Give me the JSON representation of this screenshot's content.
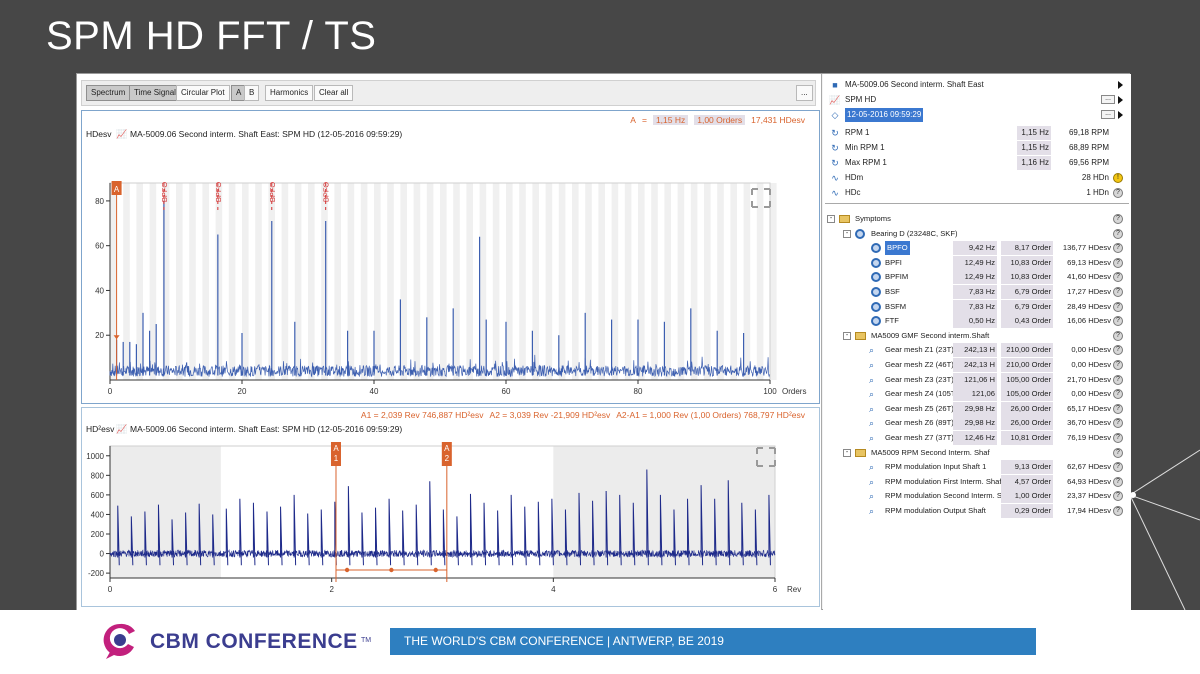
{
  "slide": {
    "title": "SPM HD FFT / TS"
  },
  "toolbar": {
    "buttons": [
      "Spectrum",
      "Time Signal",
      "Circular Plot",
      "A",
      "B",
      "Harmonics",
      "Clear all",
      "..."
    ]
  },
  "spectrum": {
    "cursor": {
      "label": "A",
      "eq": "=",
      "freq": "1,15 Hz",
      "orders": "1,00 Orders",
      "value": "17,431 HDesv"
    },
    "unit": "HDesv",
    "title": "MA-5009.06  Second interm. Shaft East: SPM HD (12-05-2016 09:59:29)",
    "x_unit": "Orders",
    "cursor_marker": "A",
    "bpfo_label": "BPFO"
  },
  "timesignal": {
    "cursors": {
      "a1": "A1  =  2,039 Rev  746,887 HD²esv",
      "a2": "A2  =  3,039 Rev  -21,909 HD²esv",
      "diff": "A2-A1  =  1,000 Rev (1,00 Orders)  768,797 HD²esv"
    },
    "unit": "HD²esv",
    "title": "MA-5009.06  Second interm. Shaft East: SPM HD (12-05-2016 09:59:29)",
    "x_unit": "Rev",
    "marker_a1": [
      "A",
      "1"
    ],
    "marker_a2": [
      "A",
      "2"
    ]
  },
  "chart_data": [
    {
      "type": "line",
      "ylabel": "HDesv",
      "xlabel": "Orders",
      "xlim": [
        0,
        100
      ],
      "ylim": [
        0,
        88
      ],
      "x_ticks": [
        0,
        20,
        40,
        60,
        80,
        100
      ],
      "y_ticks": [
        20,
        40,
        60,
        80
      ],
      "peaks": {
        "x": [
          8.17,
          16.34,
          24.51,
          32.68,
          1,
          2,
          3,
          4,
          5,
          6,
          7,
          20,
          28,
          36,
          40,
          44,
          48,
          52,
          56,
          57,
          60,
          64,
          68,
          72,
          76,
          80,
          84,
          88,
          92,
          96
        ],
        "y": [
          80,
          65,
          71,
          71,
          18,
          17,
          17,
          16,
          30,
          22,
          25,
          21,
          26,
          22,
          22,
          36,
          28,
          32,
          64,
          27,
          26,
          22,
          20,
          30,
          27,
          27,
          26,
          32,
          22,
          21
        ]
      },
      "bpfo_x": [
        8.17,
        16.34,
        24.51,
        32.68
      ],
      "cursor_x": 1,
      "grid": true
    },
    {
      "type": "line",
      "ylabel": "HD²esv",
      "xlabel": "Rev",
      "xlim": [
        0,
        6
      ],
      "ylim": [
        -250,
        1100
      ],
      "x_ticks": [
        0,
        2,
        4,
        6
      ],
      "y_ticks": [
        -200,
        0,
        200,
        400,
        600,
        800,
        1000
      ],
      "cursor_x": [
        2.039,
        3.039
      ],
      "pulse_period_rev": 0.1224,
      "pulse_heights": [
        490,
        380,
        430,
        500,
        350,
        420,
        510,
        400,
        460,
        560,
        520,
        430,
        480,
        600,
        410,
        450,
        530,
        690,
        420,
        470,
        560,
        440,
        500,
        740,
        450,
        380,
        610,
        520,
        440,
        600,
        480,
        530,
        560,
        450,
        620,
        540,
        640,
        600,
        520,
        860,
        600,
        450,
        560,
        700,
        560,
        750,
        520,
        450,
        600
      ],
      "grid": true
    }
  ],
  "info": {
    "machine": "MA-5009.06 Second interm. Shaft East",
    "measurement": "SPM HD",
    "timestamp": "12-05-2016 09:59:29",
    "rows": [
      {
        "label": "RPM 1",
        "v1": "1,15 Hz",
        "v2": "69,18 RPM"
      },
      {
        "label": "Min RPM 1",
        "v1": "1,15 Hz",
        "v2": "68,89 RPM"
      },
      {
        "label": "Max RPM 1",
        "v1": "1,16 Hz",
        "v2": "69,56 RPM"
      },
      {
        "label": "HDm",
        "v1": "",
        "v2": "28 HDn"
      },
      {
        "label": "HDc",
        "v1": "",
        "v2": "1 HDn"
      }
    ]
  },
  "symptoms": {
    "root": "Symptoms",
    "groups": [
      {
        "name": "Bearing D (23248C, SKF)",
        "items": [
          {
            "name": "BPFO",
            "f": "9,42 Hz",
            "o": "8,17 Order",
            "a": "136,77 HDesv"
          },
          {
            "name": "BPFI",
            "f": "12,49 Hz",
            "o": "10,83 Order",
            "a": "69,13 HDesv"
          },
          {
            "name": "BPFIM",
            "f": "12,49 Hz",
            "o": "10,83 Order",
            "a": "41,60 HDesv"
          },
          {
            "name": "BSF",
            "f": "7,83 Hz",
            "o": "6,79 Order",
            "a": "17,27 HDesv"
          },
          {
            "name": "BSFM",
            "f": "7,83 Hz",
            "o": "6,79 Order",
            "a": "28,49 HDesv"
          },
          {
            "name": "FTF",
            "f": "0,50 Hz",
            "o": "0,43 Order",
            "a": "16,06 HDesv"
          }
        ]
      },
      {
        "name": "MA5009 GMF Second interm.Shaft",
        "items": [
          {
            "name": "Gear mesh Z1 (23T)",
            "f": "242,13 H",
            "o": "210,00 Order",
            "a": "0,00 HDesv"
          },
          {
            "name": "Gear mesh Z2 (46T)",
            "f": "242,13 H",
            "o": "210,00 Order",
            "a": "0,00 HDesv"
          },
          {
            "name": "Gear mesh Z3 (23T)",
            "f": "121,06 H",
            "o": "105,00 Order",
            "a": "21,70 HDesv"
          },
          {
            "name": "Gear mesh Z4 (105T)",
            "f": "121,06",
            "o": "105,00 Order",
            "a": "0,00 HDesv"
          },
          {
            "name": "Gear mesh Z5 (26T)",
            "f": "29,98 Hz",
            "o": "26,00 Order",
            "a": "65,17 HDesv"
          },
          {
            "name": "Gear mesh Z6 (89T)",
            "f": "29,98 Hz",
            "o": "26,00 Order",
            "a": "36,70 HDesv"
          },
          {
            "name": "Gear mesh Z7 (37T)",
            "f": "12,46 Hz",
            "o": "10,81 Order",
            "a": "76,19 HDesv"
          }
        ]
      },
      {
        "name": "MA5009 RPM Second Interm. Shaf",
        "items": [
          {
            "name": "RPM modulation Input Shaft   1",
            "f": "9,13 Order",
            "o": "",
            "a": "62,67 HDesv"
          },
          {
            "name": "RPM modulation First Interm. Shaft",
            "f": "4,57 Order",
            "o": "",
            "a": "64,93 HDesv"
          },
          {
            "name": "RPM modulation Second Interm. Shaft",
            "f": "1,00 Order",
            "o": "",
            "a": "23,37 HDesv"
          },
          {
            "name": "RPM modulation Output Shaft",
            "f": "0,29 Order",
            "o": "",
            "a": "17,94 HDesv"
          }
        ]
      }
    ]
  },
  "footer": {
    "brand": "CBM CONFERENCE",
    "tm": "TM",
    "banner": "THE  WORLD'S CBM CONFERENCE  |  ANTWERP, BE 2019"
  },
  "colors": {
    "slide_bg": "#474747",
    "spectrum_line": "#3d5fb0",
    "timesignal_line": "#1e2a8a",
    "bpfo": "#d32f2f",
    "cursor": "#d9632d",
    "banner": "#2e7fc0",
    "brand": "#3b3d8f",
    "logo_accent": "#c2207d"
  }
}
